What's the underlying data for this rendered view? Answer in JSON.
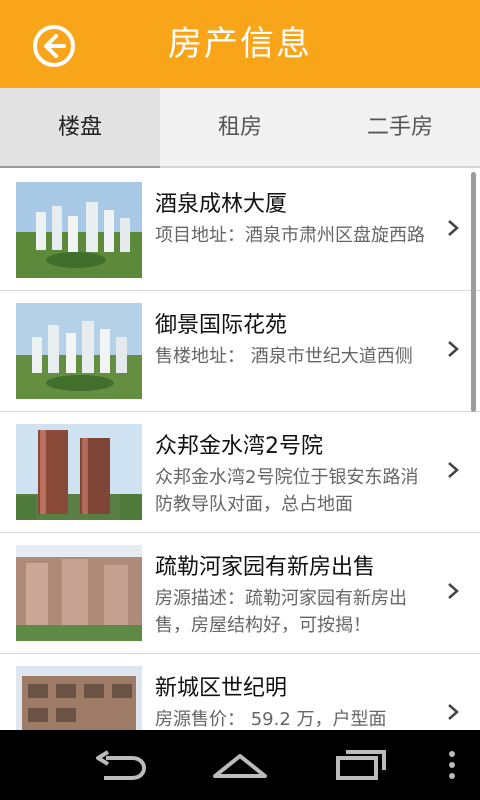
{
  "header": {
    "title": "房产信息",
    "accent_color": "#f9a51a",
    "back_icon": "back-arrow-icon"
  },
  "tabs": [
    {
      "label": "楼盘",
      "active": true
    },
    {
      "label": "租房",
      "active": false
    },
    {
      "label": "二手房",
      "active": false
    }
  ],
  "listings": [
    {
      "title": "酒泉成林大厦",
      "desc": "项目地址：酒泉市肃州区盘旋西路",
      "thumb": "residential-complex-aerial-image"
    },
    {
      "title": "御景国际花苑",
      "desc": "售楼地址： 酒泉市世纪大道西侧",
      "thumb": "residential-complex-aerial-image"
    },
    {
      "title": "众邦金水湾2号院",
      "desc": "众邦金水湾2号院位于银安东路消防教导队对面，总占地面",
      "thumb": "highrise-towers-image"
    },
    {
      "title": "疏勒河家园有新房出售",
      "desc": "房源描述：疏勒河家园有新房出售，房屋结构好，可按揭！",
      "thumb": "apartment-building-image"
    },
    {
      "title": "新城区世纪明",
      "desc": "房源售价： 59.2 万，户型面",
      "thumb": "apartment-building-image"
    }
  ],
  "navbar": {
    "icons": [
      "nav-back-icon",
      "nav-home-icon",
      "nav-recent-apps-icon",
      "nav-menu-icon"
    ]
  }
}
